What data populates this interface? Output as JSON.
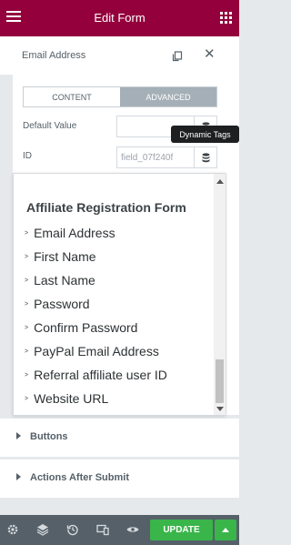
{
  "topbar": {
    "title": "Edit Form"
  },
  "header": {
    "field_label": "Email Address"
  },
  "tabs": {
    "content": "CONTENT",
    "advanced": "ADVANCED"
  },
  "fields": {
    "default_value": {
      "label": "Default Value",
      "value": ""
    },
    "id": {
      "label": "ID",
      "value": "field_07f240f"
    }
  },
  "tooltip": {
    "text": "Dynamic Tags"
  },
  "dropdown": {
    "title": "Affiliate Registration Form",
    "items": [
      "Email Address",
      "First Name",
      "Last Name",
      "Password",
      "Confirm Password",
      "PayPal Email Address",
      "Referral affiliate user ID",
      "Website URL"
    ]
  },
  "sections": {
    "buttons": "Buttons",
    "actions": "Actions After Submit"
  },
  "bottombar": {
    "update_label": "UPDATE"
  },
  "colors": {
    "brand": "#93003c",
    "update": "#39b54a",
    "bottom_bar": "#556068"
  },
  "icons": [
    "menu-icon",
    "apps-grid-icon",
    "copy-icon",
    "close-icon",
    "database-icon",
    "settings-icon",
    "layers-icon",
    "history-icon",
    "responsive-icon",
    "preview-icon",
    "chevron-up-icon"
  ]
}
